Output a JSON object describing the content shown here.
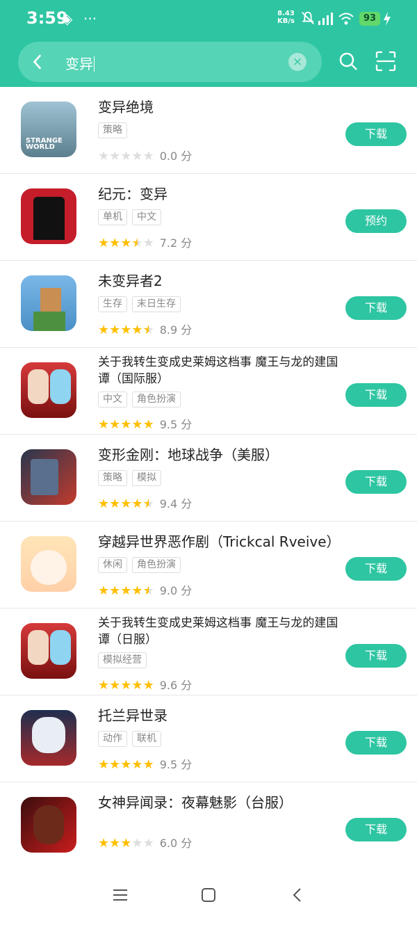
{
  "status": {
    "time": "3:59",
    "network_speed": "8.43",
    "network_unit": "KB/s",
    "battery": "93"
  },
  "search": {
    "query": "变异"
  },
  "apps": [
    {
      "title": "变异绝境",
      "tags": [
        "策略"
      ],
      "stars": 0,
      "score": "0.0 分",
      "button": "下载"
    },
    {
      "title": "纪元：变异",
      "tags": [
        "单机",
        "中文"
      ],
      "stars": 3.5,
      "score": "7.2 分",
      "button": "预约"
    },
    {
      "title": "未变异者2",
      "tags": [
        "生存",
        "末日生存"
      ],
      "stars": 4.5,
      "score": "8.9 分",
      "button": "下载"
    },
    {
      "title": "关于我转生变成史莱姆这档事 魔王与龙的建国谭（国际服）",
      "tags": [
        "中文",
        "角色扮演"
      ],
      "stars": 5,
      "score": "9.5 分",
      "button": "下载"
    },
    {
      "title": "变形金刚：地球战争（美服）",
      "tags": [
        "策略",
        "模拟"
      ],
      "stars": 4.5,
      "score": "9.4 分",
      "button": "下载"
    },
    {
      "title": "穿越异世界恶作剧（Trickcal Rveive）",
      "tags": [
        "休闲",
        "角色扮演"
      ],
      "stars": 4.5,
      "score": "9.0 分",
      "button": "下载"
    },
    {
      "title": "关于我转生变成史莱姆这档事 魔王与龙的建国谭（日服）",
      "tags": [
        "模拟经营"
      ],
      "stars": 5,
      "score": "9.6 分",
      "button": "下载"
    },
    {
      "title": "托兰异世录",
      "tags": [
        "动作",
        "联机"
      ],
      "stars": 5,
      "score": "9.5 分",
      "button": "下载"
    },
    {
      "title": "女神异闻录：夜幕魅影（台服）",
      "tags": [],
      "stars": 3,
      "score": "6.0 分",
      "button": "下载"
    }
  ],
  "icons": {
    "back": "back-arrow-icon",
    "clear": "clear-icon",
    "search": "search-icon",
    "scan": "scan-icon",
    "menu": "menu-icon",
    "home": "home-icon",
    "nav_back": "back-icon"
  },
  "colors": {
    "accent": "#2ec5a2",
    "star": "#ffbf00"
  }
}
